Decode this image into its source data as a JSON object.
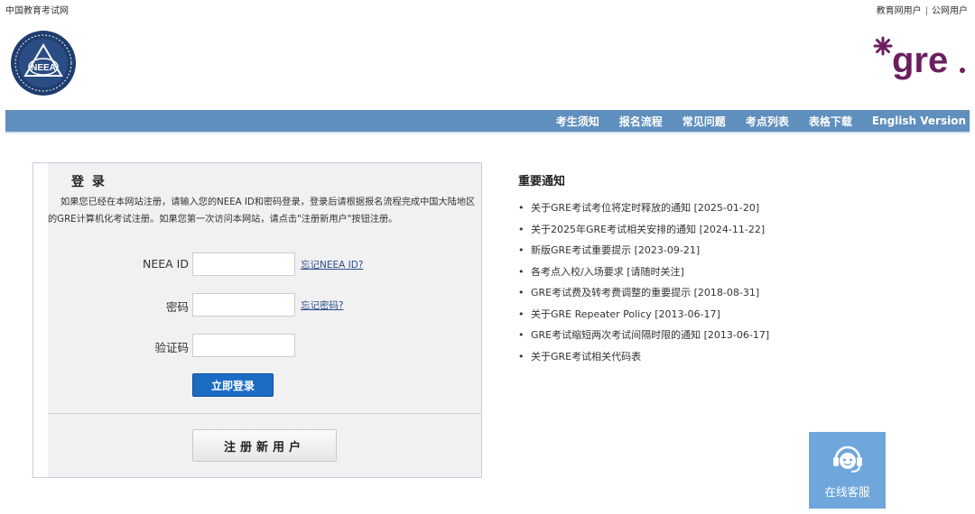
{
  "header": {
    "site_name": "中国教育考试网",
    "user_links": [
      "教育网用户",
      "公网用户"
    ],
    "separator": "|",
    "neea_logo_text": "NEEA",
    "gre_logo_text": "gre",
    "gre_logo_color": "#6b1f5e"
  },
  "nav": {
    "color": "#5f8fbd",
    "items": [
      "考生须知",
      "报名流程",
      "常见问题",
      "考点列表",
      "表格下载",
      "English Version"
    ]
  },
  "login": {
    "title": "登 录",
    "description": "如果您已经在本网站注册，请输入您的NEEA ID和密码登录，登录后请根据报名流程完成中国大陆地区的GRE计算机化考试注册。如果您第一次访问本网站，请点击\"注册新用户\"按钮注册。",
    "neea_id_label": "NEEA ID",
    "neea_id_value": "",
    "forgot_id": "忘记NEEA ID?",
    "password_label": "密码",
    "password_value": "",
    "forgot_password": "忘记密码?",
    "captcha_label": "验证码",
    "captcha_value": "",
    "login_button": "立即登录",
    "register_button": "注册新用户",
    "login_button_color": "#1c6cc4"
  },
  "notice": {
    "title": "重要通知",
    "items": [
      "关于GRE考试考位将定时释放的通知 [2025-01-20]",
      "关于2025年GRE考试相关安排的通知 [2024-11-22]",
      "新版GRE考试重要提示 [2023-09-21]",
      "各考点入校/入场要求 [请随时关注]",
      "GRE考试费及转考费调整的重要提示 [2018-08-31]",
      "关于GRE Repeater Policy [2013-06-17]",
      "GRE考试缩短两次考试间隔时限的通知 [2013-06-17]",
      "关于GRE考试相关代码表"
    ]
  },
  "service": {
    "label": "在线客服",
    "icon": "headset-icon",
    "color": "#6fa6dc"
  }
}
